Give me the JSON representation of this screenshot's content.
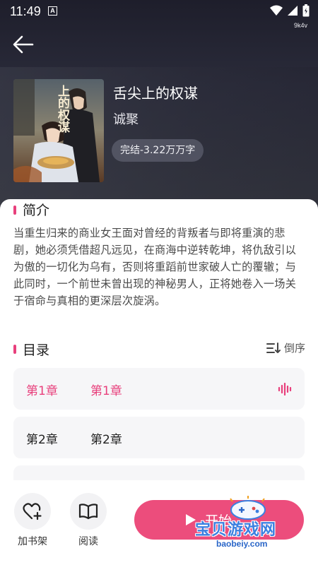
{
  "status_bar": {
    "time": "11:49",
    "notification_letter": "A",
    "build_code": "9k4v"
  },
  "book": {
    "title": "舌尖上的权谋",
    "author": "诚聚",
    "status": "完结-3.22万万字",
    "cover_text": "上的权谋"
  },
  "intro": {
    "heading": "简介",
    "text": "当重生归来的商业女王面对曾经的背叛者与即将重演的悲剧，她必须凭借超凡远见，在商海中逆转乾坤，将仇敌引以为傲的一切化为乌有，否则将重蹈前世家破人亡的覆辙；与此同时，一个前世未曾出现的神秘男人，正将她卷入一场关于宿命与真相的更深层次旋涡。"
  },
  "catalog": {
    "heading": "目录",
    "sort_label": "倒序",
    "chapters": [
      {
        "num": "第1章",
        "name": "第1章",
        "active": true
      },
      {
        "num": "第2章",
        "name": "第2章",
        "active": false
      }
    ]
  },
  "bottom": {
    "add_shelf_label": "加书架",
    "read_label": "阅读",
    "start_label": "开始"
  },
  "watermark": {
    "cn": "宝贝游戏网",
    "url": "baobeiy.com"
  },
  "colors": {
    "accent": "#ec4d7c",
    "header_bg": "#2a2b3a"
  }
}
